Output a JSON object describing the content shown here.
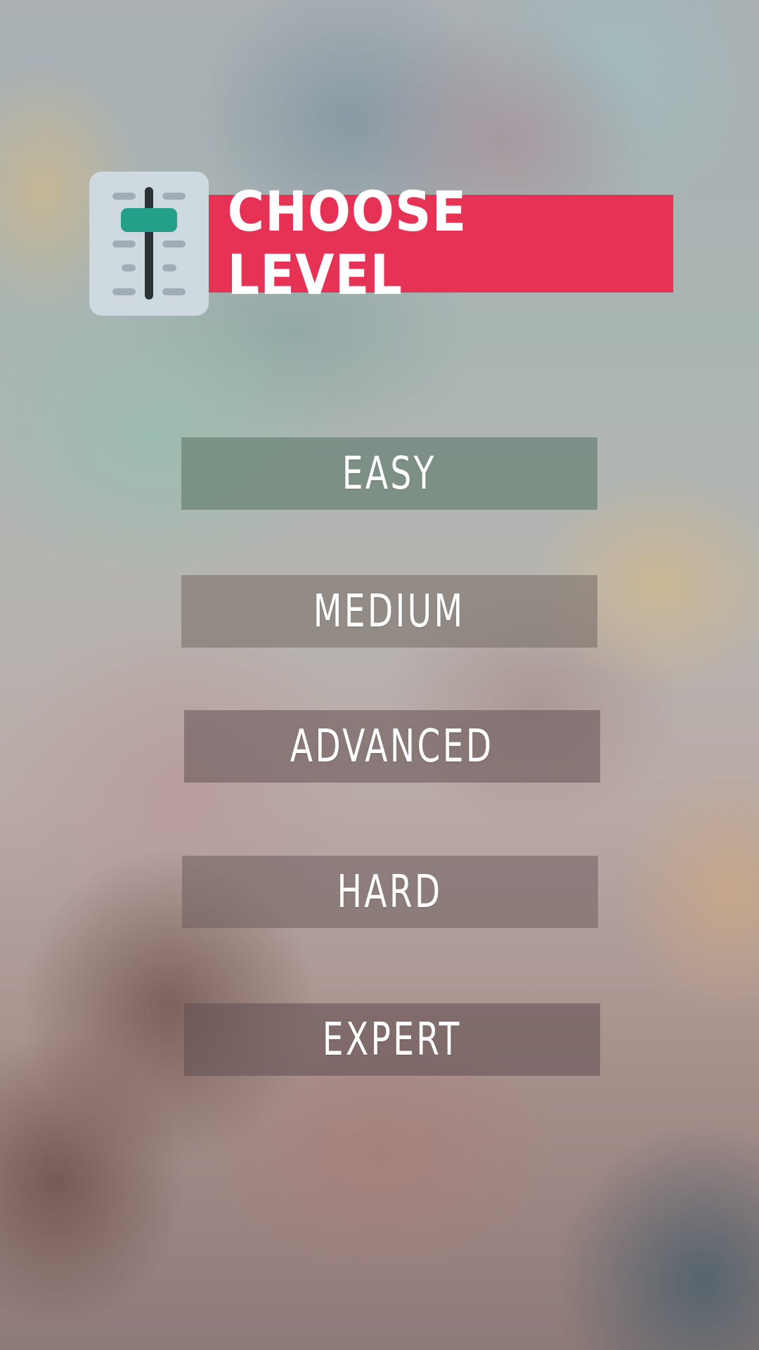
{
  "header": {
    "title": "CHOOSE LEVEL",
    "icon": "slider-settings-icon",
    "banner_color": "#e63255",
    "icon_accent_color": "#24a08a"
  },
  "levels": [
    {
      "label": "EASY"
    },
    {
      "label": "MEDIUM"
    },
    {
      "label": "ADVANCED"
    },
    {
      "label": "HARD"
    },
    {
      "label": "EXPERT"
    }
  ]
}
